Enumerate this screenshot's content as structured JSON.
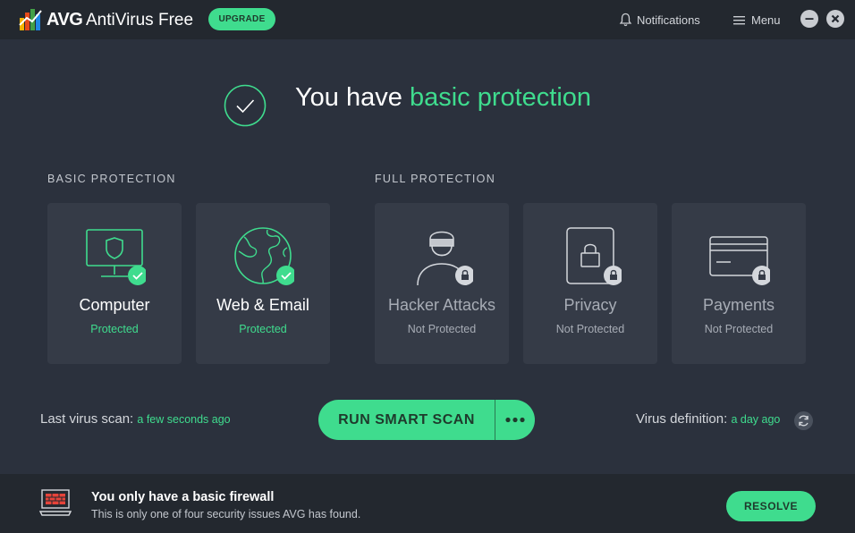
{
  "titlebar": {
    "brand": "AVG",
    "product": "AntiVirus Free",
    "upgrade_label": "UPGRADE",
    "notifications_label": "Notifications",
    "menu_label": "Menu"
  },
  "status": {
    "headline_prefix": "You have ",
    "headline_accent": "basic protection"
  },
  "sections": {
    "basic_label": "BASIC PROTECTION",
    "full_label": "FULL PROTECTION"
  },
  "cards": [
    {
      "title": "Computer",
      "status": "Protected",
      "icon": "computer-shield-icon",
      "locked": false
    },
    {
      "title": "Web & Email",
      "status": "Protected",
      "icon": "globe-icon",
      "locked": false
    },
    {
      "title": "Hacker Attacks",
      "status": "Not Protected",
      "icon": "hacker-icon",
      "locked": true
    },
    {
      "title": "Privacy",
      "status": "Not Protected",
      "icon": "privacy-lock-icon",
      "locked": true
    },
    {
      "title": "Payments",
      "status": "Not Protected",
      "icon": "credit-card-icon",
      "locked": true
    }
  ],
  "scan": {
    "last_scan_label": "Last virus scan:",
    "last_scan_value": "a few seconds ago",
    "button_label": "RUN SMART SCAN",
    "definition_label": "Virus definition:",
    "definition_value": "a day ago"
  },
  "footer": {
    "title": "You only have a basic firewall",
    "subtitle": "This is only one of four security issues AVG has found.",
    "resolve_label": "RESOLVE"
  },
  "colors": {
    "background": "#2b313d",
    "titlebar": "#23282f",
    "card": "#353b47",
    "accent": "#3fdc8e"
  }
}
